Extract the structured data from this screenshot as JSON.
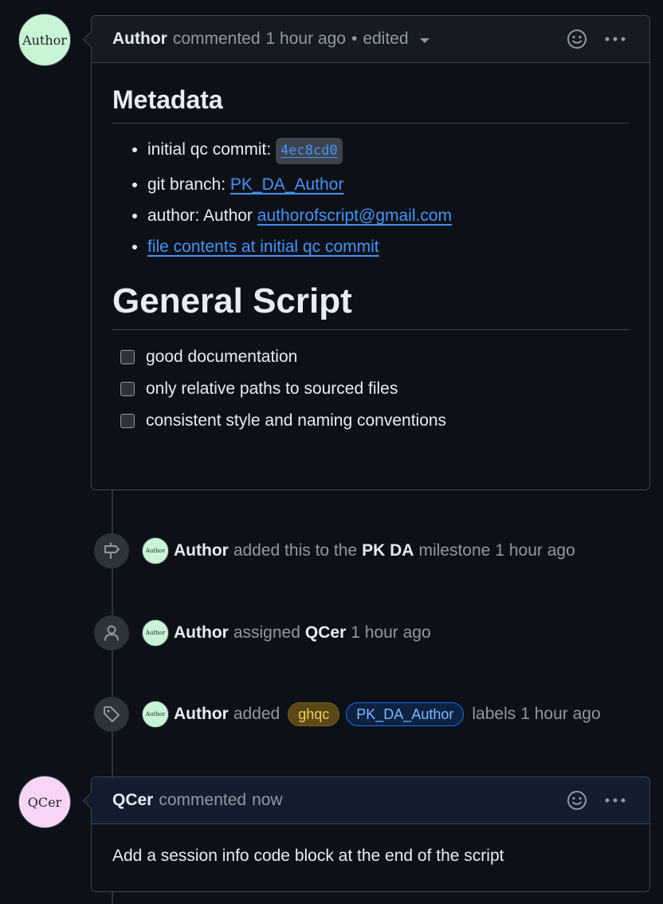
{
  "first_comment": {
    "avatar_text": "Author",
    "author": "Author",
    "action": "commented",
    "time": "1 hour ago",
    "separator": "•",
    "edited": "edited",
    "metadata_heading": "Metadata",
    "metadata_items": {
      "commit_label": "initial qc commit:",
      "commit_hash": "4ec8cd0",
      "branch_label": "git branch:",
      "branch_link": "PK_DA_Author",
      "author_label": "author: Author",
      "author_email": "authorofscript@gmail.com",
      "file_link": "file contents at initial qc commit"
    },
    "general_heading": "General Script",
    "checklist": [
      "good documentation",
      "only relative paths to sourced files",
      "consistent style and naming conventions"
    ]
  },
  "events": {
    "milestone": {
      "avatar_text": "Author",
      "actor": "Author",
      "text_before": "added this to the",
      "milestone": "PK DA",
      "text_after": "milestone",
      "time": "1 hour ago"
    },
    "assigned": {
      "avatar_text": "Author",
      "actor": "Author",
      "text": "assigned",
      "assignee": "QCer",
      "time": "1 hour ago"
    },
    "labels": {
      "avatar_text": "Author",
      "actor": "Author",
      "text": "added",
      "label1": "ghqc",
      "label2": "PK_DA_Author",
      "text_after": "labels",
      "time": "1 hour ago"
    }
  },
  "second_comment": {
    "avatar_text": "QCer",
    "author": "QCer",
    "action": "commented",
    "time": "now",
    "body": "Add a session info code block at the end of the script"
  },
  "icons": {
    "reaction": "smiley-icon",
    "more": "kebab-horizontal-icon",
    "milestone": "milestone-icon",
    "assign": "person-icon",
    "label": "tag-icon"
  },
  "colors": {
    "background": "#0d1117",
    "link": "#4493f8",
    "label_ghqc": "#f2cc60",
    "label_pk": "#79b8ff"
  }
}
